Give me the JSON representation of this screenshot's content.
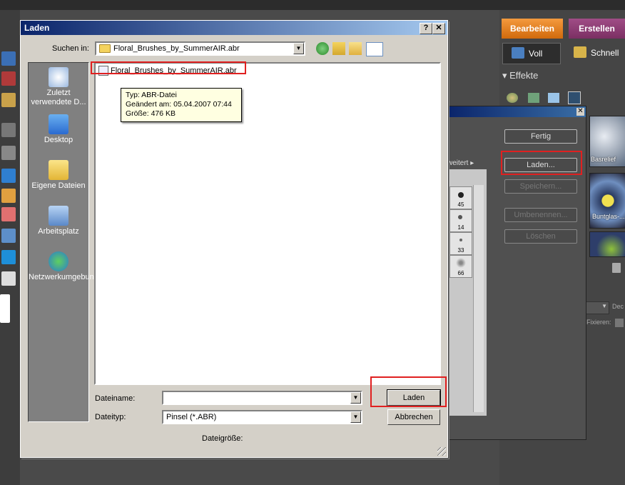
{
  "app": {
    "tabs": {
      "edit": "Bearbeiten",
      "create": "Erstellen"
    },
    "modes": {
      "full": "Voll",
      "quick": "Schnell"
    },
    "effects_header": "Effekte",
    "thumbnails": [
      "Basrelief",
      "Buntglas-..."
    ],
    "side_labels": {
      "dec": "Dec",
      "fixieren": "Fixieren:"
    },
    "accent_edit": "#e8821f",
    "accent_create": "#8c3a74"
  },
  "brush_dialog": {
    "buttons": {
      "done": "Fertig",
      "load": "Laden...",
      "save": "Speichern...",
      "rename": "Umbenennen...",
      "delete": "Löschen"
    },
    "advanced": "weitert ▸",
    "brush_sizes": [
      "45",
      "14",
      "33",
      "66"
    ]
  },
  "dialog": {
    "title": "Laden",
    "help_btn": "?",
    "close_btn": "✕",
    "look_in_label": "Suchen in:",
    "look_in_value": "Floral_Brushes_by_SummerAIR.abr",
    "places": [
      {
        "label": "Zuletzt verwendete D...",
        "icon": "recent-documents-icon"
      },
      {
        "label": "Desktop",
        "icon": "desktop-icon"
      },
      {
        "label": "Eigene Dateien",
        "icon": "my-documents-icon"
      },
      {
        "label": "Arbeitsplatz",
        "icon": "my-computer-icon"
      },
      {
        "label": "Netzwerkumgebung",
        "icon": "network-icon"
      }
    ],
    "files": [
      {
        "name": "Floral_Brushes_by_SummerAIR.abr"
      }
    ],
    "tooltip": {
      "type": "Typ: ABR-Datei",
      "modified": "Geändert am: 05.04.2007 07:44",
      "size": "Größe: 476 KB"
    },
    "filename_label": "Dateiname:",
    "filename_value": "",
    "filetype_label": "Dateityp:",
    "filetype_value": "Pinsel (*.ABR)",
    "filesize_label": "Dateigröße:",
    "open_btn": "Laden",
    "cancel_btn": "Abbrechen"
  }
}
